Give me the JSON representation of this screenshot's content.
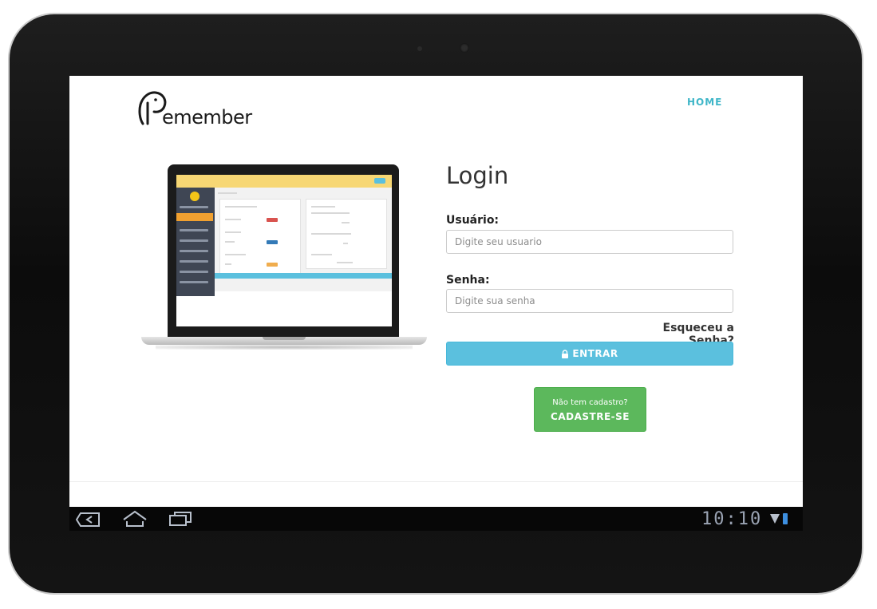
{
  "brand": {
    "logo_text": "emember",
    "logo_icon": "elephant-r-icon"
  },
  "nav": {
    "home_label": "HOME"
  },
  "login": {
    "title": "Login",
    "username_label": "Usuário:",
    "username_placeholder": "Digite seu usuario",
    "username_value": "",
    "password_label": "Senha:",
    "password_placeholder": "Digite sua senha",
    "password_value": "",
    "forgot_label": "Esqueceu a Senha?",
    "submit_label": "ENTRAR",
    "submit_icon": "lock-icon"
  },
  "signup": {
    "prompt": "Não tem cadastro?",
    "label": "CADASTRE-SE"
  },
  "illustration": {
    "description_icon": "laptop-dashboard-preview"
  },
  "system_bar": {
    "clock": "10:10",
    "nav_icons": [
      "back-icon",
      "home-icon",
      "recent-apps-icon"
    ],
    "status_icons": [
      "signal-icon",
      "battery-icon"
    ]
  },
  "colors": {
    "accent_info": "#5bc0de",
    "success": "#5cb85c",
    "nav_link": "#3fb6c8",
    "tablet_bezel": "#111111"
  }
}
